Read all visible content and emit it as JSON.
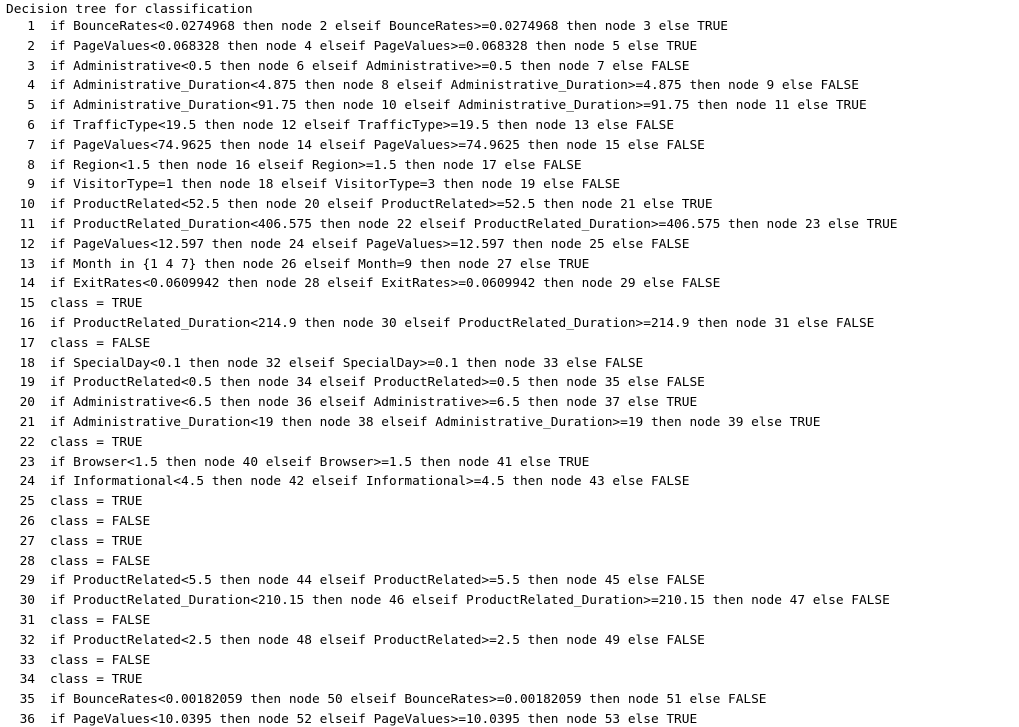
{
  "title": "Decision tree for classification",
  "lines": [
    {
      "num": "1",
      "text": "if BounceRates<0.0274968 then node 2 elseif BounceRates>=0.0274968 then node 3 else TRUE"
    },
    {
      "num": "2",
      "text": "if PageValues<0.068328 then node 4 elseif PageValues>=0.068328 then node 5 else TRUE"
    },
    {
      "num": "3",
      "text": "if Administrative<0.5 then node 6 elseif Administrative>=0.5 then node 7 else FALSE"
    },
    {
      "num": "4",
      "text": "if Administrative_Duration<4.875 then node 8 elseif Administrative_Duration>=4.875 then node 9 else FALSE"
    },
    {
      "num": "5",
      "text": "if Administrative_Duration<91.75 then node 10 elseif Administrative_Duration>=91.75 then node 11 else TRUE"
    },
    {
      "num": "6",
      "text": "if TrafficType<19.5 then node 12 elseif TrafficType>=19.5 then node 13 else FALSE"
    },
    {
      "num": "7",
      "text": "if PageValues<74.9625 then node 14 elseif PageValues>=74.9625 then node 15 else FALSE"
    },
    {
      "num": "8",
      "text": "if Region<1.5 then node 16 elseif Region>=1.5 then node 17 else FALSE"
    },
    {
      "num": "9",
      "text": "if VisitorType=1 then node 18 elseif VisitorType=3 then node 19 else FALSE"
    },
    {
      "num": "10",
      "text": "if ProductRelated<52.5 then node 20 elseif ProductRelated>=52.5 then node 21 else TRUE"
    },
    {
      "num": "11",
      "text": "if ProductRelated_Duration<406.575 then node 22 elseif ProductRelated_Duration>=406.575 then node 23 else TRUE"
    },
    {
      "num": "12",
      "text": "if PageValues<12.597 then node 24 elseif PageValues>=12.597 then node 25 else FALSE"
    },
    {
      "num": "13",
      "text": "if Month in {1 4 7} then node 26 elseif Month=9 then node 27 else TRUE"
    },
    {
      "num": "14",
      "text": "if ExitRates<0.0609942 then node 28 elseif ExitRates>=0.0609942 then node 29 else FALSE"
    },
    {
      "num": "15",
      "text": "class = TRUE"
    },
    {
      "num": "16",
      "text": "if ProductRelated_Duration<214.9 then node 30 elseif ProductRelated_Duration>=214.9 then node 31 else FALSE"
    },
    {
      "num": "17",
      "text": "class = FALSE"
    },
    {
      "num": "18",
      "text": "if SpecialDay<0.1 then node 32 elseif SpecialDay>=0.1 then node 33 else FALSE"
    },
    {
      "num": "19",
      "text": "if ProductRelated<0.5 then node 34 elseif ProductRelated>=0.5 then node 35 else FALSE"
    },
    {
      "num": "20",
      "text": "if Administrative<6.5 then node 36 elseif Administrative>=6.5 then node 37 else TRUE"
    },
    {
      "num": "21",
      "text": "if Administrative_Duration<19 then node 38 elseif Administrative_Duration>=19 then node 39 else TRUE"
    },
    {
      "num": "22",
      "text": "class = TRUE"
    },
    {
      "num": "23",
      "text": "if Browser<1.5 then node 40 elseif Browser>=1.5 then node 41 else TRUE"
    },
    {
      "num": "24",
      "text": "if Informational<4.5 then node 42 elseif Informational>=4.5 then node 43 else FALSE"
    },
    {
      "num": "25",
      "text": "class = TRUE"
    },
    {
      "num": "26",
      "text": "class = FALSE"
    },
    {
      "num": "27",
      "text": "class = TRUE"
    },
    {
      "num": "28",
      "text": "class = FALSE"
    },
    {
      "num": "29",
      "text": "if ProductRelated<5.5 then node 44 elseif ProductRelated>=5.5 then node 45 else FALSE"
    },
    {
      "num": "30",
      "text": "if ProductRelated_Duration<210.15 then node 46 elseif ProductRelated_Duration>=210.15 then node 47 else FALSE"
    },
    {
      "num": "31",
      "text": "class = FALSE"
    },
    {
      "num": "32",
      "text": "if ProductRelated<2.5 then node 48 elseif ProductRelated>=2.5 then node 49 else FALSE"
    },
    {
      "num": "33",
      "text": "class = FALSE"
    },
    {
      "num": "34",
      "text": "class = TRUE"
    },
    {
      "num": "35",
      "text": "if BounceRates<0.00182059 then node 50 elseif BounceRates>=0.00182059 then node 51 else FALSE"
    },
    {
      "num": "36",
      "text": "if PageValues<10.0395 then node 52 elseif PageValues>=10.0395 then node 53 else TRUE"
    }
  ]
}
